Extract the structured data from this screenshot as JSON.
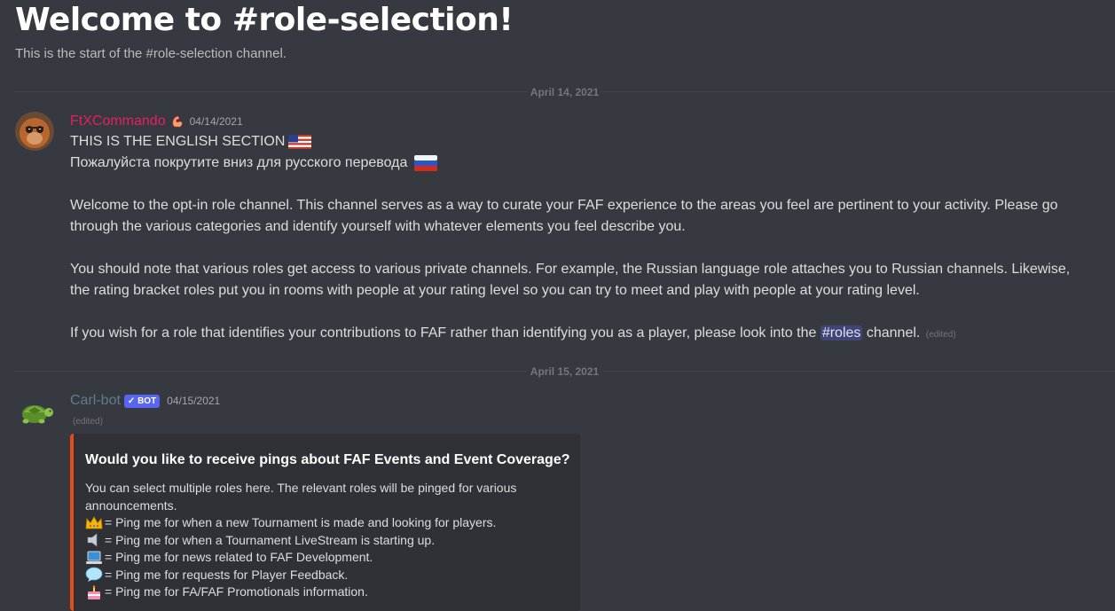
{
  "channel": {
    "welcome_title": "Welcome to #role-selection!",
    "welcome_subtitle": "This is the start of the #role-selection channel."
  },
  "dividers": [
    "April 14, 2021",
    "April 15, 2021"
  ],
  "messages": [
    {
      "author": "FtXCommando",
      "author_color": "#e91e63",
      "timestamp": "04/14/2021",
      "lines": {
        "l1": "THIS IS THE ENGLISH SECTION",
        "l2": "Пожалуйста покрутите вниз для русского перевода",
        "p1": "Welcome to the opt-in role channel. This channel serves as a way to curate your FAF experience to the areas you feel are pertinent to your activity. Please go through the various categories and identify yourself with whatever elements you feel describe you.",
        "p2": "You should note that various roles get access to various private channels. For example, the Russian language role attaches you to Russian channels. Likewise, the rating bracket roles put you in rooms with people at your rating level so you can try to meet and play with people at your rating level.",
        "p3_before": "If you wish for a role that identifies your contributions to FAF rather than identifying you as a player, please look into the",
        "p3_mention": "#roles",
        "p3_after": "channel.",
        "edited": "(edited)"
      }
    },
    {
      "author": "Carl-bot",
      "author_color": "#607d8b",
      "bot_tag": "✓ BOT",
      "timestamp": "04/15/2021",
      "edited": "(edited)",
      "embed": {
        "accent": "#e64d15",
        "title": "Would you like to receive pings about FAF Events and Event Coverage?",
        "description": "You can select multiple roles here. The relevant roles will be pinged for various announcements.",
        "items": [
          {
            "icon": "crown-icon",
            "text": "= Ping me for when a new Tournament is made and looking for players."
          },
          {
            "icon": "speaker-icon",
            "text": "= Ping me for when a Tournament LiveStream is starting up."
          },
          {
            "icon": "laptop-icon",
            "text": "= Ping me for news related to FAF Development."
          },
          {
            "icon": "speech-bubble-icon",
            "text": "= Ping me for requests for Player Feedback."
          },
          {
            "icon": "cake-icon",
            "text": "= Ping me for FA/FAF Promotionals information."
          }
        ]
      }
    }
  ]
}
